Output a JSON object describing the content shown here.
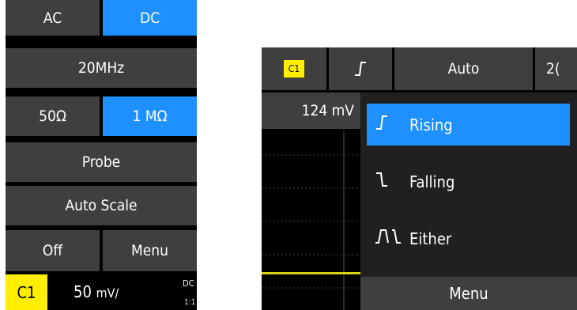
{
  "left_panel": {
    "coupling": {
      "ac": "AC",
      "dc": "DC",
      "selected": "DC"
    },
    "bandwidth": "20MHz",
    "impedance": {
      "low": "50Ω",
      "high": "1 MΩ",
      "selected": "1 MΩ"
    },
    "probe": "Probe",
    "auto_scale": "Auto Scale",
    "off": "Off",
    "menu": "Menu",
    "status": {
      "channel": "C1",
      "scale_value": "50",
      "scale_unit": "mV/",
      "coupling": "DC",
      "ratio": "1:1"
    }
  },
  "trigger": {
    "channel": "C1",
    "slope_icon": "rising-edge-icon",
    "mode": "Auto",
    "partial_value": "2(",
    "level": "124 mV",
    "menu": {
      "items": [
        {
          "icon": "rising-edge-icon",
          "label": "Rising",
          "selected": true
        },
        {
          "icon": "falling-edge-icon",
          "label": "Falling",
          "selected": false
        },
        {
          "icon": "either-edge-icon",
          "label": "Either",
          "selected": false
        }
      ],
      "footer": "Menu"
    }
  },
  "colors": {
    "accent": "#1e90ff",
    "channel": "#ffee00",
    "button": "#3f3f3f"
  }
}
